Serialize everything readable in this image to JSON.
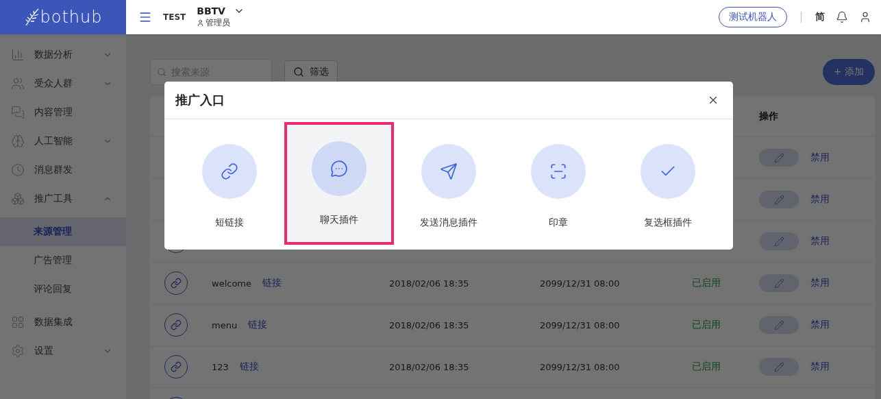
{
  "header": {
    "logo": "bothub",
    "org": "TEST",
    "account": "BBTV",
    "role": "管理员",
    "robot_button": "测试机器人",
    "language": "简"
  },
  "sidebar": {
    "items": [
      {
        "label": "数据分析",
        "expanded": false
      },
      {
        "label": "受众人群",
        "expanded": false
      },
      {
        "label": "内容管理"
      },
      {
        "label": "人工智能",
        "expanded": false
      },
      {
        "label": "消息群发"
      },
      {
        "label": "推广工具",
        "expanded": true,
        "children": [
          {
            "label": "来源管理",
            "selected": true
          },
          {
            "label": "广告管理",
            "selected": false
          },
          {
            "label": "评论回复",
            "selected": false
          }
        ]
      },
      {
        "label": "数据集成"
      },
      {
        "label": "设置",
        "expanded": false
      }
    ]
  },
  "toolbar": {
    "search": {
      "placeholder": "搜索来源"
    },
    "filter_button": "筛选",
    "add_button": "+ 添加"
  },
  "table": {
    "columns": [
      {
        "label": "操作"
      }
    ],
    "rows": [
      {
        "action": "禁用"
      },
      {
        "action": "禁用"
      },
      {
        "action": "禁用"
      },
      {
        "name": "welcome",
        "link": "链接",
        "created": "2018/02/06 18:35",
        "expires": "2099/12/31 08:00",
        "status": "已启用",
        "action": "禁用"
      },
      {
        "name": "menu",
        "link": "链接",
        "created": "2018/02/06 18:35",
        "expires": "2099/12/31 08:00",
        "status": "已启用",
        "action": "禁用"
      },
      {
        "name": "123",
        "link": "链接",
        "created": "2018/02/06 18:35",
        "expires": "2099/12/31 08:00",
        "status": "已启用",
        "action": "禁用"
      },
      {}
    ]
  },
  "dialog": {
    "title": "推广入口",
    "options": [
      {
        "label": "短链接",
        "selected": false
      },
      {
        "label": "聊天插件",
        "selected": true
      },
      {
        "label": "发送消息插件",
        "selected": false
      },
      {
        "label": "印章",
        "selected": false
      },
      {
        "label": "复选框插件",
        "selected": false
      }
    ]
  }
}
